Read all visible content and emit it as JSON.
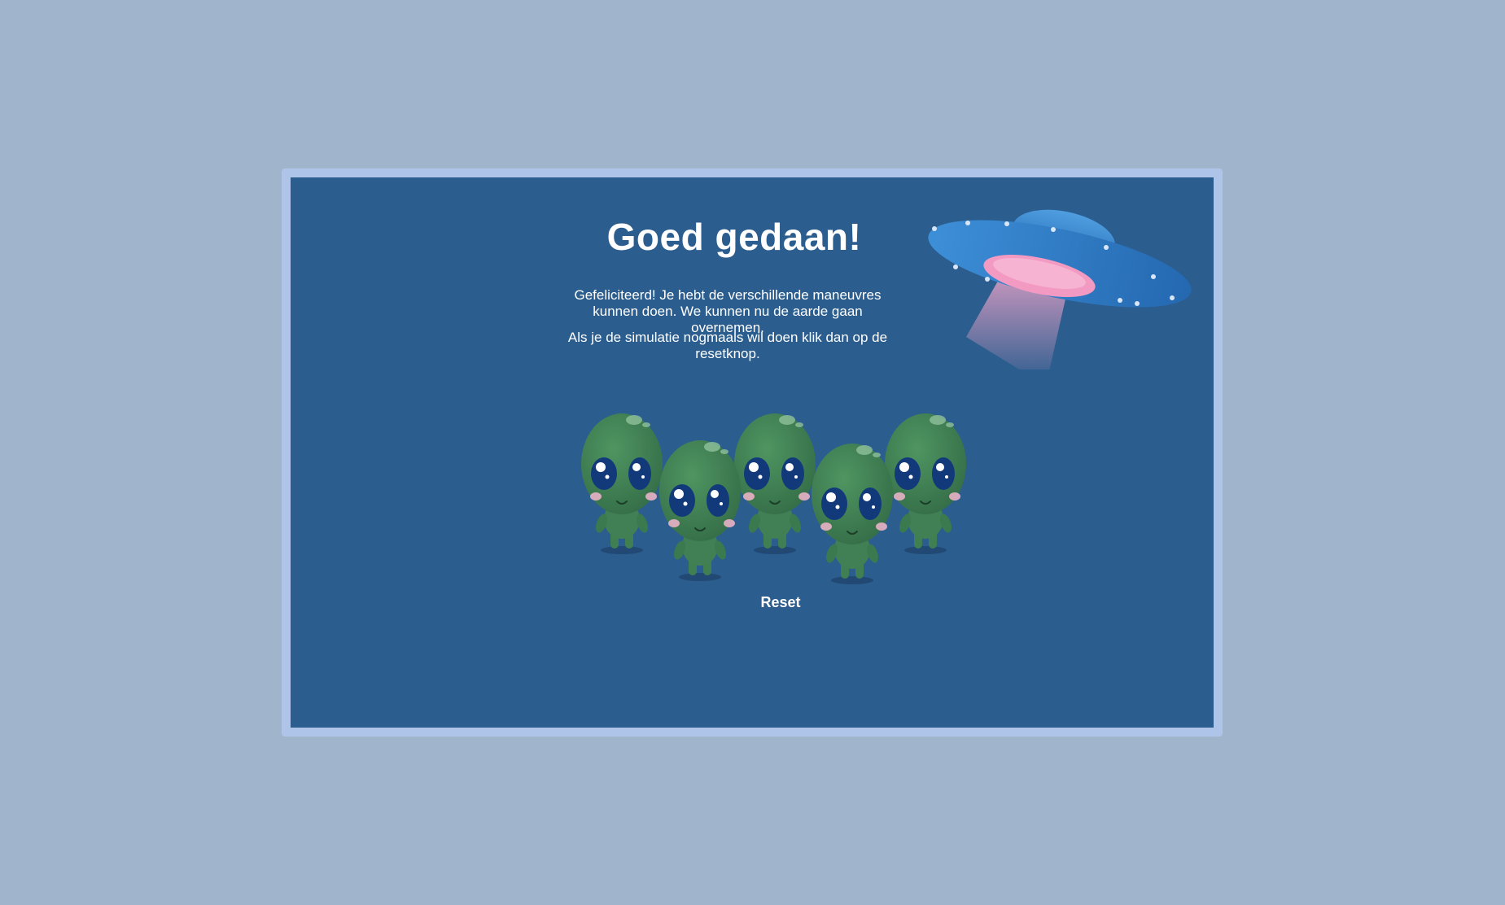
{
  "dialog": {
    "title": "Goed gedaan!",
    "message_1": "Gefeliciteerd! Je hebt de verschillende maneuvres kunnen doen. We kunnen nu de aarde gaan overnemen.",
    "message_2": "Als je de simulatie nogmaals wil doen klik dan op de resetknop.",
    "reset_label": "Reset"
  },
  "illustrations": {
    "ufo": "ufo-icon",
    "aliens": "aliens-group-icon",
    "alien_count": 5
  },
  "colors": {
    "page_background": "#a0b5cb",
    "frame_border": "#aec4e8",
    "panel_background": "#2b5d8e",
    "text": "#ffffff",
    "alien_green": "#3f7f52",
    "ufo_blue": "#2f7fc8",
    "beam_pink": "#f5a3c8"
  }
}
